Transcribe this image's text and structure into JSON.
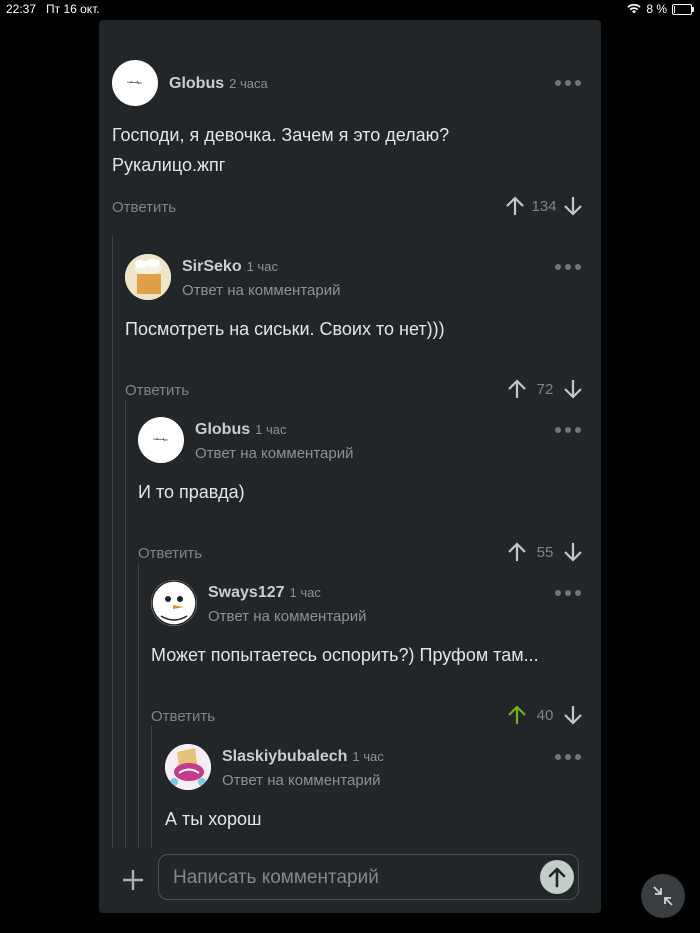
{
  "status_bar": {
    "time": "22:37",
    "date": "Пт 16 окт.",
    "battery": "8 %",
    "battery_level": 0.08
  },
  "colors": {
    "panel": "#222628",
    "upvoted": "#6fb516",
    "arrow": "#c2c7ca"
  },
  "comments": [
    {
      "username": "Globus",
      "time": "2 часа",
      "reply_note": "",
      "lines": [
        "Господи, я девочка. Зачем я это делаю?",
        "Рукалицо.жпг"
      ],
      "reply_label": "Ответить",
      "score": "134",
      "upvoted": false
    },
    {
      "username": "SirSeko",
      "time": "1 час",
      "reply_note": "Ответ на комментарий",
      "lines": [
        "Посмотреть на сиськи.  Своих то нет)))"
      ],
      "reply_label": "Ответить",
      "score": "72",
      "upvoted": false
    },
    {
      "username": "Globus",
      "time": "1 час",
      "reply_note": "Ответ на комментарий",
      "lines": [
        "И то правда)"
      ],
      "reply_label": "Ответить",
      "score": "55",
      "upvoted": false
    },
    {
      "username": "Sways127",
      "time": "1 час",
      "reply_note": "Ответ на комментарий",
      "lines": [
        "Может попытаетесь оспорить?) Пруфом там..."
      ],
      "reply_label": "Ответить",
      "score": "40",
      "upvoted": true
    },
    {
      "username": "Slaskiybubalech",
      "time": "1 час",
      "reply_note": "Ответ на комментарий",
      "lines": [
        "А ты хорош"
      ],
      "reply_label": "",
      "score": "",
      "upvoted": false
    }
  ],
  "composer": {
    "placeholder": "Написать комментарий"
  }
}
